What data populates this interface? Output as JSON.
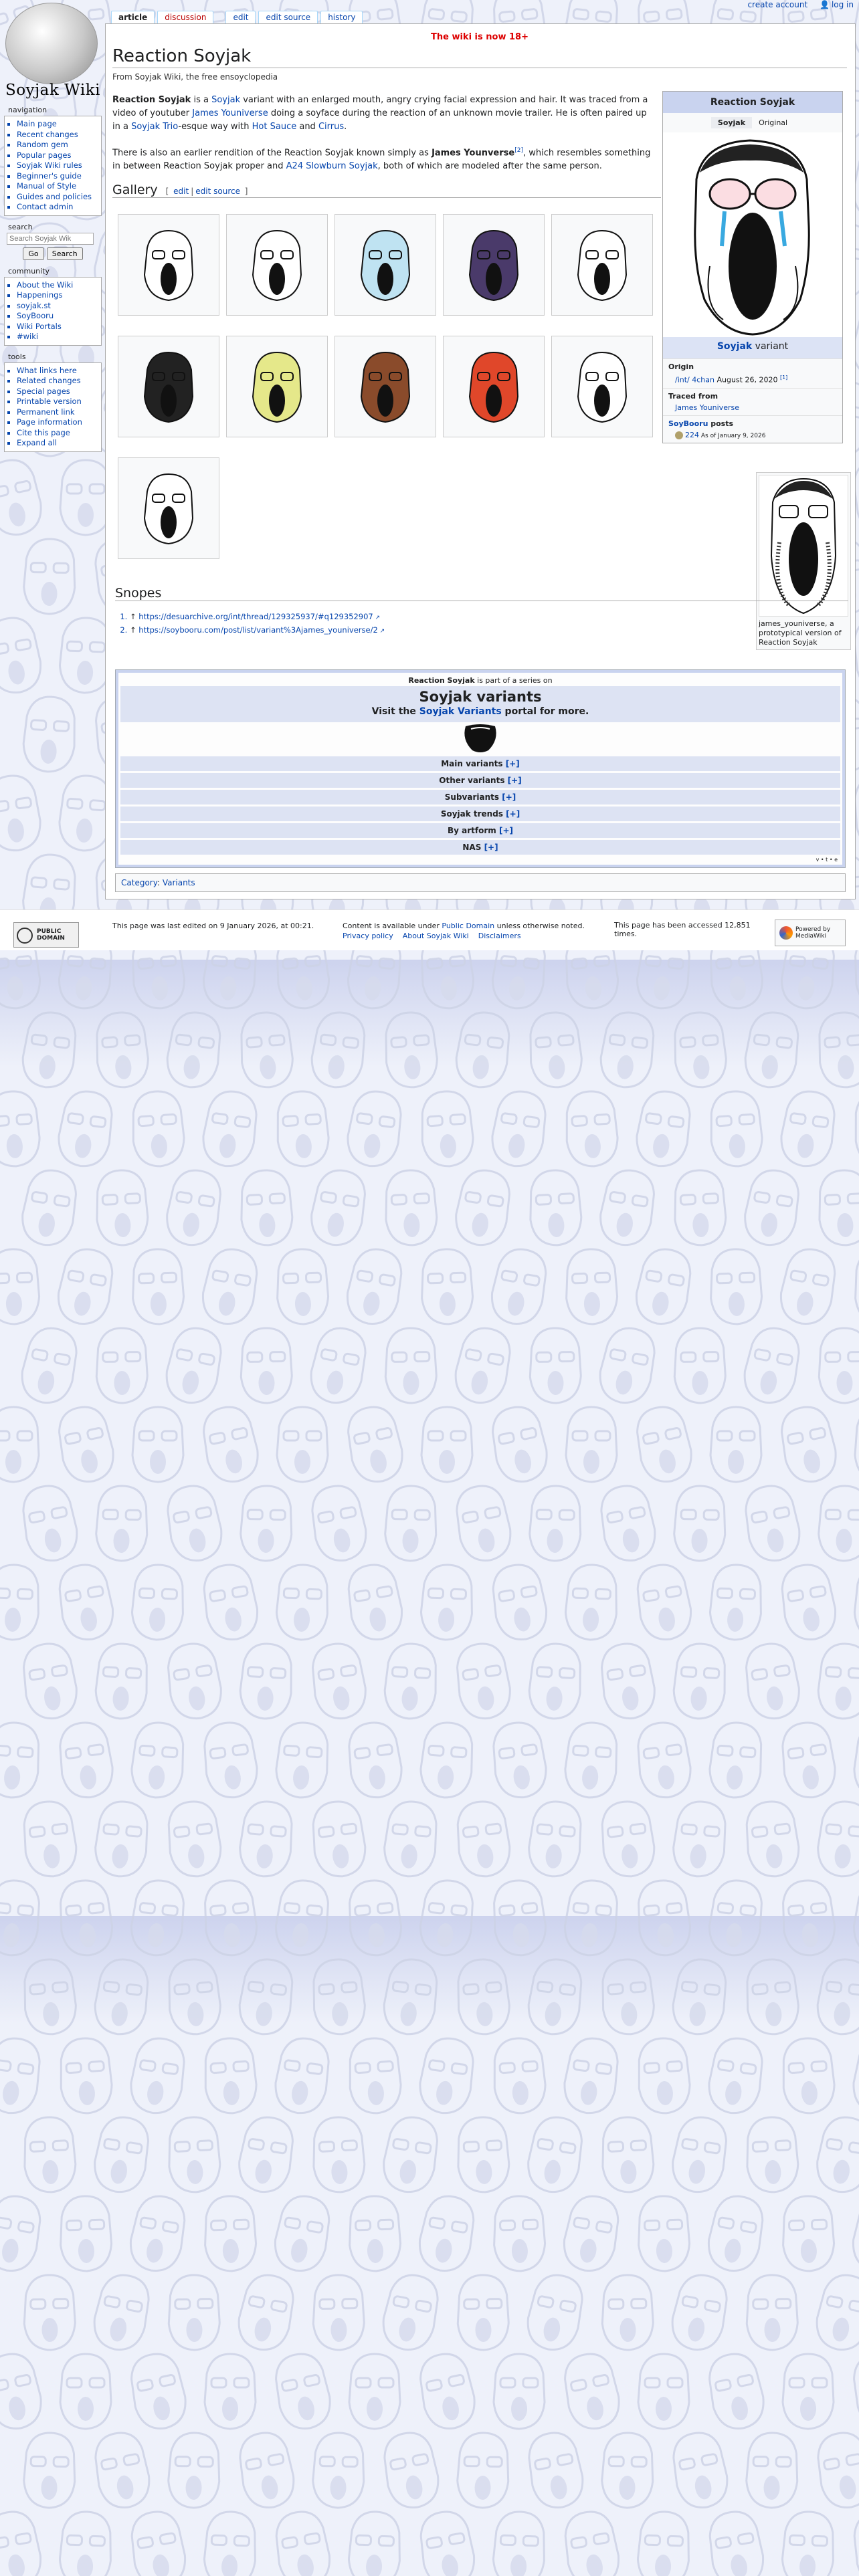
{
  "personal": {
    "create_account": "create account",
    "log_in": "log in"
  },
  "logo": {
    "wordmark": "Soyjak Wiki"
  },
  "tabs": {
    "article": "article",
    "discussion": "discussion",
    "edit": "edit",
    "edit_source": "edit source",
    "history": "history"
  },
  "sidebar": {
    "navigation_title": "navigation",
    "navigation": [
      "Main page",
      "Recent changes",
      "Random gem",
      "Popular pages",
      "Soyjak Wiki rules",
      "Beginner's guide",
      "Manual of Style",
      "Guides and policies",
      "Contact admin"
    ],
    "search_title": "search",
    "search_placeholder": "Search Soyjak Wik",
    "go_label": "Go",
    "search_label": "Search",
    "community_title": "community",
    "community": [
      "About the Wiki",
      "Happenings",
      "soyjak.st",
      "SoyBooru",
      "Wiki Portals",
      "#wiki"
    ],
    "tools_title": "tools",
    "tools": [
      "What links here",
      "Related changes",
      "Special pages",
      "Printable version",
      "Permanent link",
      "Page information",
      "Cite this page",
      "Expand all"
    ]
  },
  "notice": "The wiki is now 18+",
  "article": {
    "title": "Reaction Soyjak",
    "subtitle": "From Soyjak Wiki, the free ensoyclopedia",
    "p1_a": "Reaction Soyjak",
    "p1_b": " is a ",
    "p1_c": "Soyjak",
    "p1_d": " variant with an enlarged mouth, angry crying facial expression and hair. It was traced from a video of youtuber ",
    "p1_e": "James Youniverse",
    "p1_f": " doing a soyface during the reaction of an unknown movie trailer. He is often paired up in a ",
    "p1_g": "Soyjak Trio",
    "p1_h": "-esque way with ",
    "p1_i": "Hot Sauce",
    "p1_j": " and ",
    "p1_k": "Cirrus",
    "p1_l": ".",
    "p2_a": "There is also an earlier rendition of the Reaction Soyjak known simply as ",
    "p2_b": "James Younverse",
    "p2_ref": "[2]",
    "p2_c": ", which resembles something in between Reaction Soyjak proper and ",
    "p2_d": "A24 Slowburn Soyjak",
    "p2_e": ", both of which are modeled after the same person.",
    "gallery_heading": "Gallery",
    "edit": "edit",
    "edit_source": "edit source",
    "snopes_heading": "Snopes",
    "refs": [
      "https://desuarchive.org/int/thread/129325937/#q129352907",
      "https://soybooru.com/post/list/variant%3Ajames_youniverse/2"
    ]
  },
  "infobox": {
    "title": "Reaction Soyjak",
    "tab_soyjak": "Soyjak",
    "tab_original": "Original",
    "caption_link": "Soyjak",
    "caption_rest": " variant",
    "origin_label": "Origin",
    "origin_site": "/int/ 4chan",
    "origin_date": " August 26, 2020 ",
    "origin_ref": "[1]",
    "traced_label": "Traced from",
    "traced_value": "James Youniverse",
    "posts_label_link": "SoyBooru",
    "posts_label_rest": " posts",
    "posts_count": "224",
    "posts_asof": " As of January 9, 2026"
  },
  "thumb": {
    "caption": "james_youniverse, a prototypical version of Reaction Soyjak"
  },
  "navbox": {
    "series_a": "Reaction Soyjak",
    "series_b": " is part of a series on",
    "name": "Soyjak variants",
    "visit_a": "Visit the ",
    "visit_link": "Soyjak Variants",
    "visit_b": " portal for more.",
    "rows": [
      "Main variants",
      "Other variants",
      "Subvariants",
      "Soyjak trends",
      "By artform",
      "NAS"
    ],
    "expand": "[+]",
    "vte": "v • t • e"
  },
  "category": {
    "label": "Category",
    "colon": ": ",
    "value": "Variants"
  },
  "footer": {
    "last_edited": "This page was last edited on 9 January 2026, at 00:21.",
    "content_a": "Content is available under ",
    "content_link": "Public Domain",
    "content_b": " unless otherwise noted.",
    "privacy": "Privacy policy",
    "about": "About Soyjak Wiki",
    "disclaimers": "Disclaimers",
    "accessed": "This page has been accessed 12,851 times.",
    "pd_badge": "PUBLIC DOMAIN",
    "mw_badge": "Powered by MediaWiki"
  }
}
